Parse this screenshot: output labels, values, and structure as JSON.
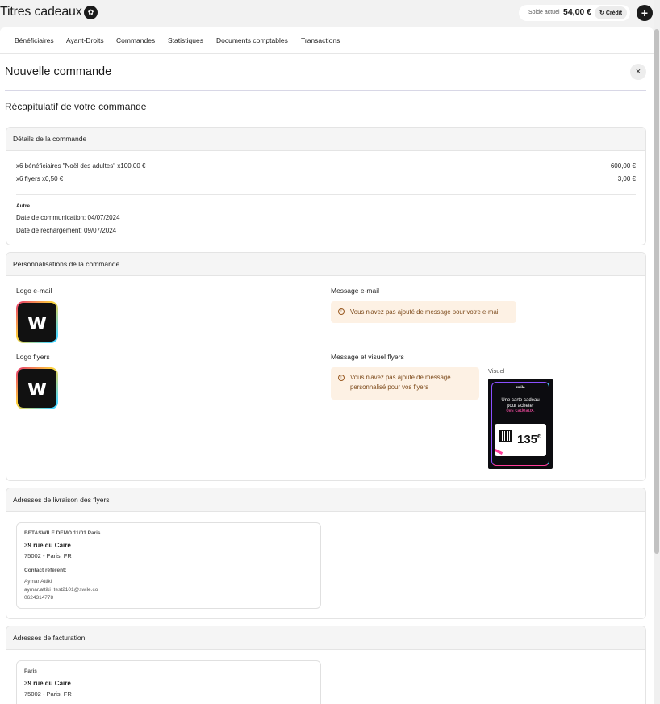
{
  "app": {
    "title": "Titres cadeaux",
    "badge_icon": "gift-icon"
  },
  "balance": {
    "label": "Solde actuel :",
    "value": "54,00 €",
    "credit_label": "Crédit"
  },
  "nav": {
    "tabs": [
      "Bénéficiaires",
      "Ayant-Droits",
      "Commandes",
      "Statistiques",
      "Documents comptables",
      "Transactions"
    ]
  },
  "page": {
    "title": "Nouvelle commande",
    "close_icon": "×",
    "summary_title": "Récapitulatif de votre commande"
  },
  "details": {
    "title": "Détails de la commande",
    "lines": [
      {
        "label": "x6 bénéficiaires \"Noël des adultes\" x100,00 €",
        "amount": "600,00 €"
      },
      {
        "label": "x6 flyers x0,50 €",
        "amount": "3,00 €"
      }
    ],
    "category": "Autre",
    "communication_date": "Date de communication: 04/07/2024",
    "recharge_date": "Date de rechargement: 09/07/2024"
  },
  "personalisation": {
    "title": "Personnalisations de la commande",
    "email_logo_label": "Logo e-mail",
    "flyers_logo_label": "Logo flyers",
    "email_message_label": "Message e-mail",
    "email_message_warning": "Vous n'avez pas ajouté de message pour votre e-mail",
    "flyers_message_label": "Message et visuel flyers",
    "flyers_message_warning_1": "Vous n'avez pas ajouté de message",
    "flyers_message_warning_2": "personnalisé pour vos flyers",
    "visual_label": "Visuel",
    "logo_letter": "w",
    "flyer": {
      "brand": "swile",
      "headline_1": "Une carte cadeau",
      "headline_2": "pour acheter",
      "accent": "ces cadeaux.",
      "amount": "135",
      "currency": "€"
    }
  },
  "delivery": {
    "title": "Adresses de livraison des flyers",
    "name": "BETASWILE DEMO 11/01 Paris",
    "street": "39 rue du Caire",
    "city": "75002 - Paris, FR",
    "contact_label": "Contact référent:",
    "contact_name": "Aymar Attiki",
    "contact_email": "aymar.attiki+test2101@swile.co",
    "contact_phone": "0624314778"
  },
  "billing": {
    "title": "Adresses de facturation",
    "name": "Paris",
    "street": "39 rue du Caire",
    "city": "75002 - Paris, FR"
  }
}
